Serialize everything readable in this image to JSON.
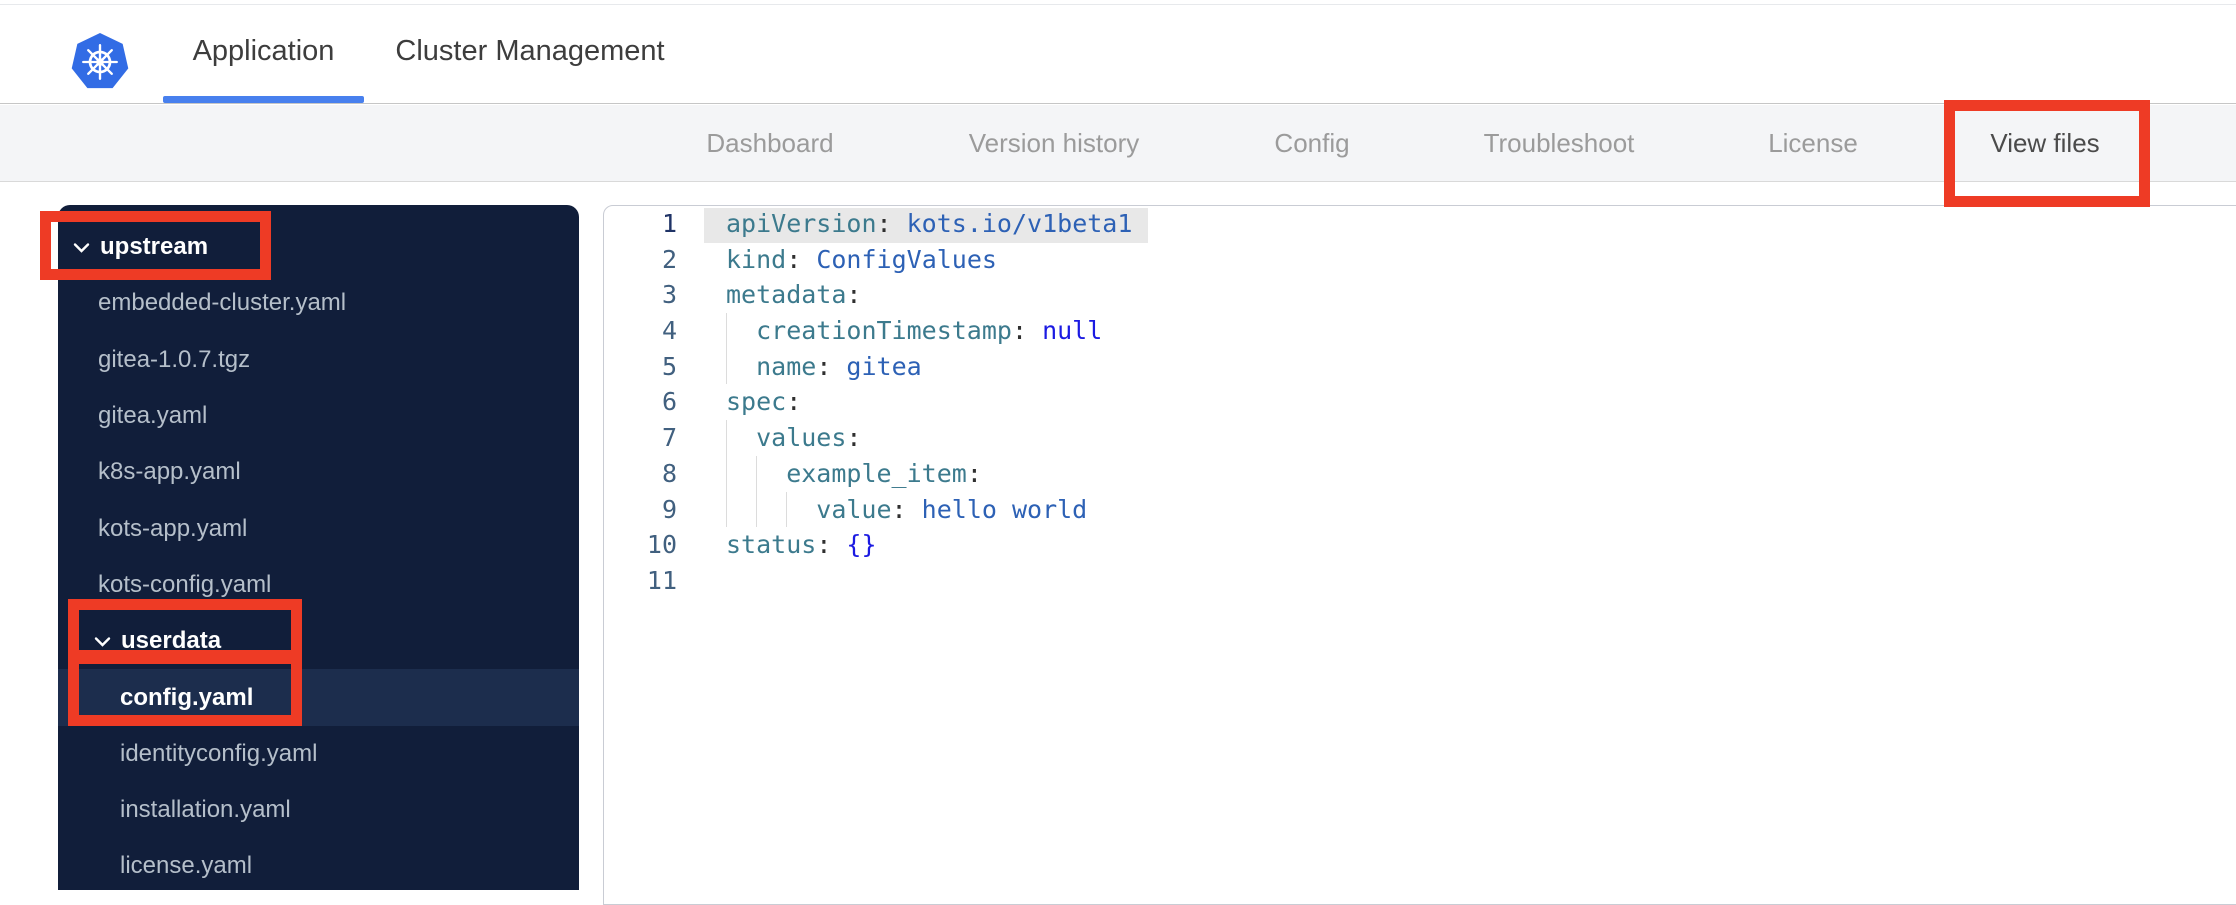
{
  "header": {
    "logo": "kubernetes-logo",
    "tabs": [
      {
        "label": "Application",
        "active": true
      },
      {
        "label": "Cluster Management",
        "active": false
      }
    ]
  },
  "nav": {
    "items": [
      {
        "label": "Dashboard",
        "active": false
      },
      {
        "label": "Version history",
        "active": false
      },
      {
        "label": "Config",
        "active": false
      },
      {
        "label": "Troubleshoot",
        "active": false
      },
      {
        "label": "License",
        "active": false
      },
      {
        "label": "View files",
        "active": true
      }
    ]
  },
  "sidebar": {
    "items": [
      {
        "label": "upstream",
        "type": "folder",
        "level": 1,
        "expanded": true,
        "selected": false
      },
      {
        "label": "embedded-cluster.yaml",
        "type": "file",
        "level": 1,
        "selected": false
      },
      {
        "label": "gitea-1.0.7.tgz",
        "type": "file",
        "level": 1,
        "selected": false
      },
      {
        "label": "gitea.yaml",
        "type": "file",
        "level": 1,
        "selected": false
      },
      {
        "label": "k8s-app.yaml",
        "type": "file",
        "level": 1,
        "selected": false
      },
      {
        "label": "kots-app.yaml",
        "type": "file",
        "level": 1,
        "selected": false
      },
      {
        "label": "kots-config.yaml",
        "type": "file",
        "level": 1,
        "selected": false
      },
      {
        "label": "userdata",
        "type": "folder",
        "level": 2,
        "expanded": true,
        "selected": false
      },
      {
        "label": "config.yaml",
        "type": "file",
        "level": 2,
        "selected": true
      },
      {
        "label": "identityconfig.yaml",
        "type": "file",
        "level": 2,
        "selected": false
      },
      {
        "label": "installation.yaml",
        "type": "file",
        "level": 2,
        "selected": false
      },
      {
        "label": "license.yaml",
        "type": "file",
        "level": 2,
        "selected": false
      }
    ]
  },
  "editor": {
    "language": "yaml",
    "lines": [
      {
        "num": "1",
        "active": true,
        "indent": 0,
        "tokens": [
          [
            "key",
            "apiVersion"
          ],
          [
            "p",
            ":"
          ],
          [
            "str",
            " kots.io/v1beta1"
          ]
        ]
      },
      {
        "num": "2",
        "indent": 0,
        "tokens": [
          [
            "key",
            "kind"
          ],
          [
            "p",
            ":"
          ],
          [
            "str",
            " ConfigValues"
          ]
        ]
      },
      {
        "num": "3",
        "indent": 0,
        "tokens": [
          [
            "key",
            "metadata"
          ],
          [
            "p",
            ":"
          ]
        ]
      },
      {
        "num": "4",
        "indent": 1,
        "tokens": [
          [
            "key",
            "creationTimestamp"
          ],
          [
            "p",
            ":"
          ],
          [
            "const",
            " null"
          ]
        ]
      },
      {
        "num": "5",
        "indent": 1,
        "tokens": [
          [
            "key",
            "name"
          ],
          [
            "p",
            ":"
          ],
          [
            "str",
            " gitea"
          ]
        ]
      },
      {
        "num": "6",
        "indent": 0,
        "tokens": [
          [
            "key",
            "spec"
          ],
          [
            "p",
            ":"
          ]
        ]
      },
      {
        "num": "7",
        "indent": 1,
        "tokens": [
          [
            "key",
            "values"
          ],
          [
            "p",
            ":"
          ]
        ]
      },
      {
        "num": "8",
        "indent": 2,
        "tokens": [
          [
            "key",
            "example_item"
          ],
          [
            "p",
            ":"
          ]
        ]
      },
      {
        "num": "9",
        "indent": 3,
        "tokens": [
          [
            "key",
            "value"
          ],
          [
            "p",
            ":"
          ],
          [
            "str",
            " hello world"
          ]
        ]
      },
      {
        "num": "10",
        "indent": 0,
        "tokens": [
          [
            "key",
            "status"
          ],
          [
            "p",
            ":"
          ],
          [
            "const",
            " {}"
          ]
        ]
      },
      {
        "num": "11",
        "indent": 0,
        "tokens": []
      }
    ]
  },
  "annotations": {
    "highlight_color": "#ee3b25",
    "boxes": [
      "view-files-tab",
      "upstream-folder",
      "userdata-folder",
      "config-yaml-file"
    ]
  },
  "colors": {
    "accent_blue": "#4880ee",
    "k8s_blue": "#326ce5",
    "sidebar_bg": "#111e3a",
    "sidebar_selected_bg": "#1c2d4d",
    "annotation_red": "#ee3b25",
    "code_key": "#3c7a8d",
    "code_punct": "#2f2f2f",
    "code_value": "#2d61b5",
    "code_constant": "#1b1ae2",
    "line_number": "#41607f",
    "active_line_number": "#1f3366",
    "active_line_bg": "#e8e8e8"
  }
}
